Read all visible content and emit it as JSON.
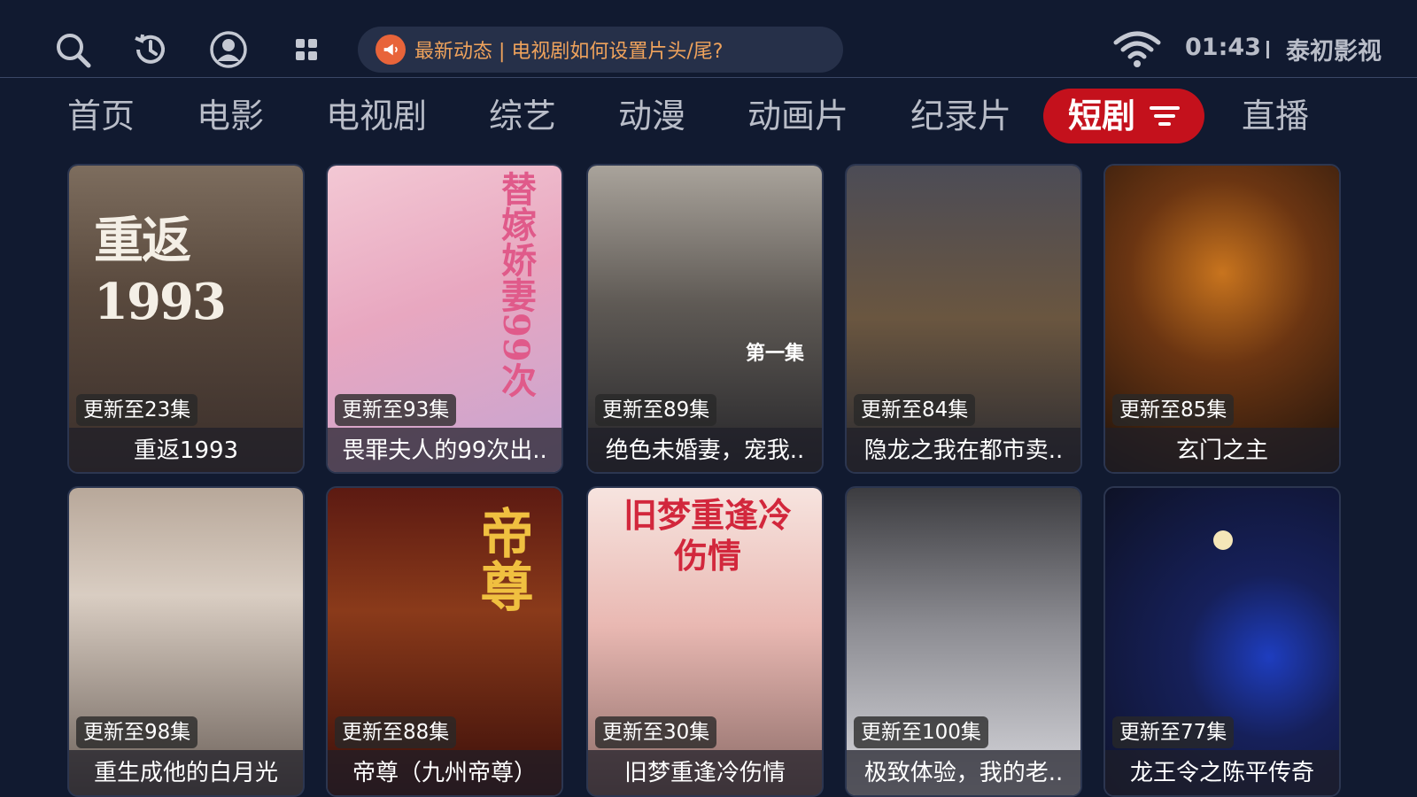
{
  "topbar": {
    "icons": [
      "search-icon",
      "history-icon",
      "user-icon",
      "apps-grid-icon"
    ],
    "notice": "最新动态 | 电视剧如何设置片头/尾?",
    "time": "01:43",
    "app_name": "泰初影视"
  },
  "nav": {
    "tabs": [
      "首页",
      "电影",
      "电视剧",
      "综艺",
      "动漫",
      "动画片",
      "纪录片",
      "短剧",
      "直播"
    ],
    "active": "短剧"
  },
  "grid": {
    "rows": [
      [
        {
          "badge": "更新至23集",
          "title": "重返1993",
          "poster_text": "重返1993"
        },
        {
          "badge": "更新至93集",
          "title": "畏罪夫人的99次出..",
          "poster_text": "替嫁娇妻99次"
        },
        {
          "badge": "更新至89集",
          "title": "绝色未婚妻，宠我..",
          "poster_text": "第一集"
        },
        {
          "badge": "更新至84集",
          "title": "隐龙之我在都市卖..",
          "poster_text": ""
        },
        {
          "badge": "更新至85集",
          "title": "玄门之主",
          "poster_text": ""
        }
      ],
      [
        {
          "badge": "更新至98集",
          "title": "重生成他的白月光",
          "poster_text": ""
        },
        {
          "badge": "更新至88集",
          "title": "帝尊（九州帝尊）",
          "poster_text": "帝尊"
        },
        {
          "badge": "更新至30集",
          "title": "旧梦重逢冷伤情",
          "poster_text": "旧梦重逢冷伤情"
        },
        {
          "badge": "更新至100集",
          "title": "极致体验，我的老..",
          "poster_text": ""
        },
        {
          "badge": "更新至77集",
          "title": "龙王令之陈平传奇",
          "poster_text": ""
        }
      ]
    ]
  },
  "colors": {
    "background": "#111a30",
    "active_tab": "#c4111c",
    "notice_text": "#f0a35c",
    "notice_icon": "#e8643a"
  }
}
